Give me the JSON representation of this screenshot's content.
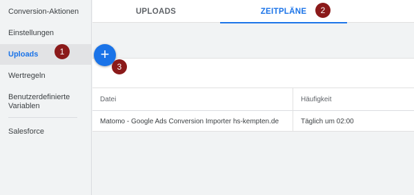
{
  "sidebar": {
    "items": [
      {
        "label": "Conversion-Aktionen"
      },
      {
        "label": "Einstellungen"
      },
      {
        "label": "Uploads"
      },
      {
        "label": "Wertregeln"
      },
      {
        "label": "Benutzerdefinierte Variablen"
      },
      {
        "label": "Salesforce"
      }
    ]
  },
  "tabs": [
    {
      "label": "UPLOADS"
    },
    {
      "label": "ZEITPLÄNE"
    }
  ],
  "fab": {
    "label": "+"
  },
  "table": {
    "headers": [
      "Datei",
      "Häufigkeit"
    ],
    "rows": [
      [
        "Matomo - Google Ads Conversion Importer hs-kempten.de",
        "Täglich um 02:00"
      ]
    ]
  },
  "markers": [
    "1",
    "2",
    "3"
  ],
  "colors": {
    "accent": "#1a73e8",
    "marker": "#8b1a1a"
  }
}
